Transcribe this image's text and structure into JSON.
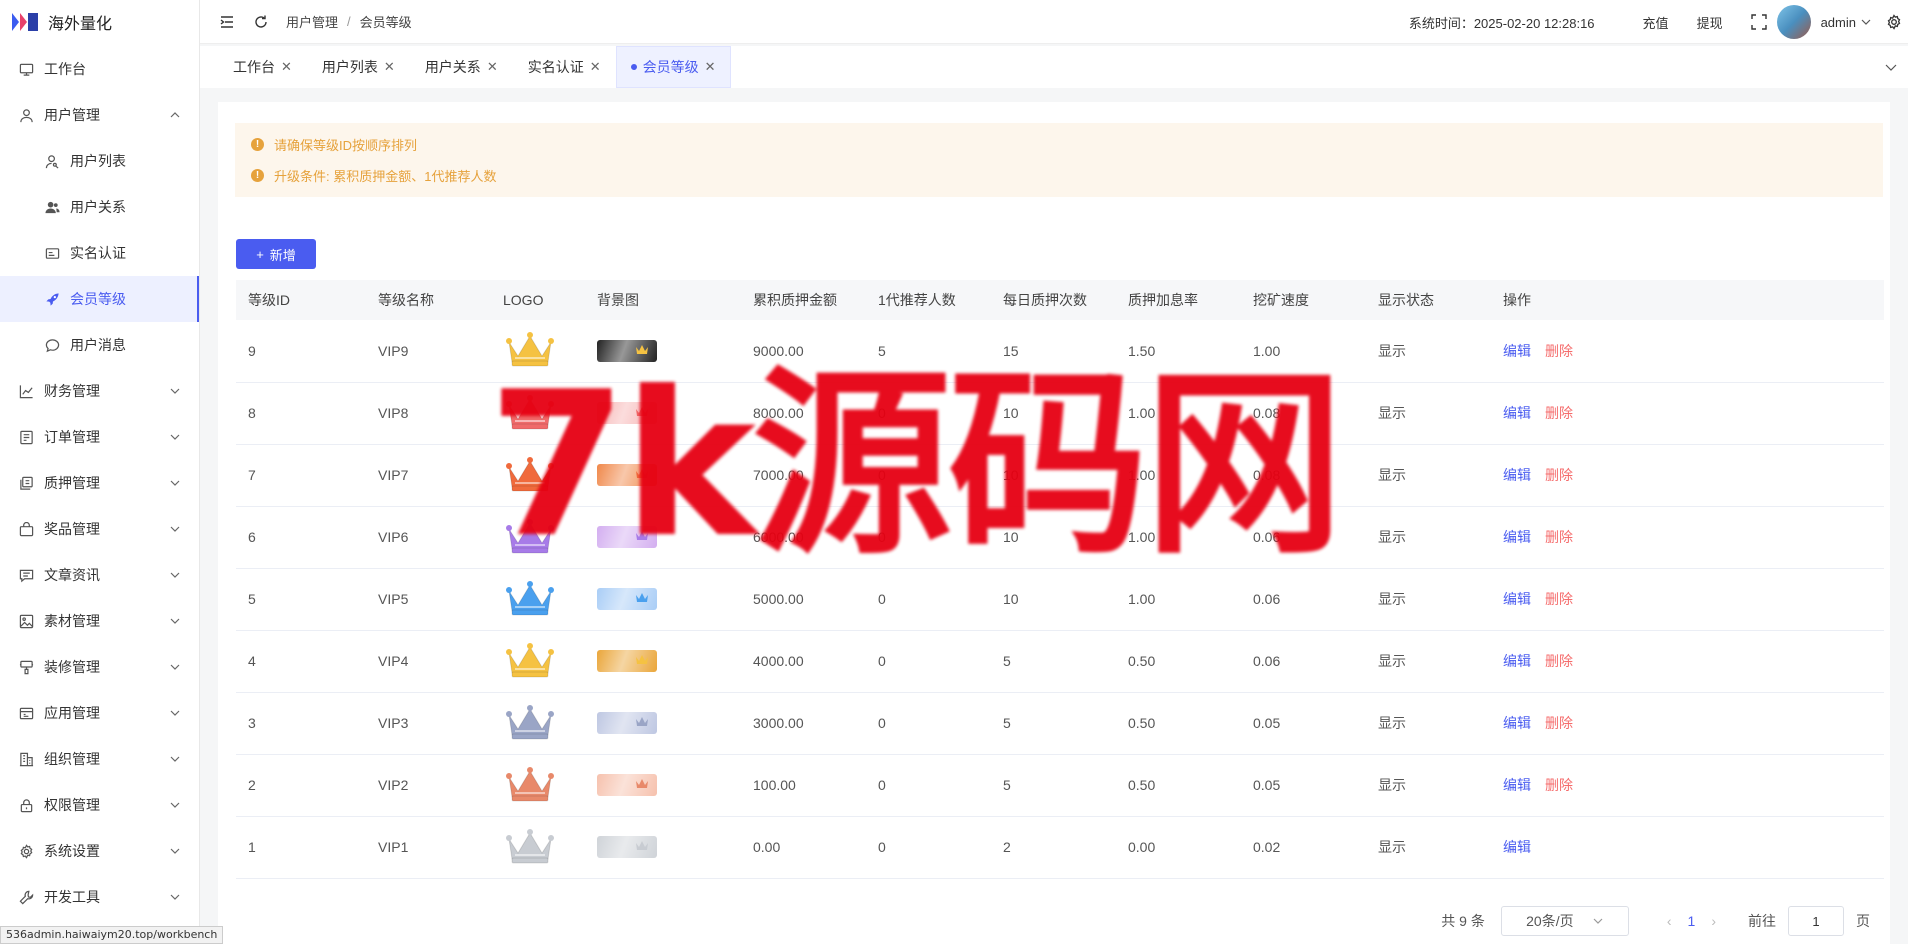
{
  "app": {
    "title": "海外量化"
  },
  "sidebar": {
    "items": [
      {
        "label": "工作台",
        "icon": "monitor-icon"
      },
      {
        "label": "用户管理",
        "icon": "user-icon",
        "expanded": true,
        "children": [
          {
            "label": "用户列表",
            "icon": "user-search-icon"
          },
          {
            "label": "用户关系",
            "icon": "users-icon"
          },
          {
            "label": "实名认证",
            "icon": "id-card-icon"
          },
          {
            "label": "会员等级",
            "icon": "rocket-icon",
            "active": true
          },
          {
            "label": "用户消息",
            "icon": "message-icon"
          }
        ]
      },
      {
        "label": "财务管理",
        "icon": "chart-icon"
      },
      {
        "label": "订单管理",
        "icon": "order-icon"
      },
      {
        "label": "质押管理",
        "icon": "stack-icon"
      },
      {
        "label": "奖品管理",
        "icon": "bag-icon"
      },
      {
        "label": "文章资讯",
        "icon": "article-icon"
      },
      {
        "label": "素材管理",
        "icon": "image-icon"
      },
      {
        "label": "装修管理",
        "icon": "brush-icon"
      },
      {
        "label": "应用管理",
        "icon": "app-icon"
      },
      {
        "label": "组织管理",
        "icon": "building-icon"
      },
      {
        "label": "权限管理",
        "icon": "lock-icon"
      },
      {
        "label": "系统设置",
        "icon": "gear-icon"
      },
      {
        "label": "开发工具",
        "icon": "tool-icon"
      }
    ]
  },
  "header": {
    "breadcrumb": [
      "用户管理",
      "会员等级"
    ],
    "sys_time": "系统时间：2025-02-20 12:28:16",
    "recharge": "充值",
    "withdraw": "提现",
    "user": "admin"
  },
  "tabs": [
    {
      "label": "工作台"
    },
    {
      "label": "用户列表"
    },
    {
      "label": "用户关系"
    },
    {
      "label": "实名认证"
    },
    {
      "label": "会员等级",
      "active": true
    }
  ],
  "alerts": [
    "请确保等级ID按顺序排列",
    "升级条件: 累积质押金额、1代推荐人数"
  ],
  "add_button": "新增",
  "table": {
    "columns": [
      "等级ID",
      "等级名称",
      "LOGO",
      "背景图",
      "累积质押金额",
      "1代推荐人数",
      "每日质押次数",
      "质押加息率",
      "挖矿速度",
      "显示状态",
      "操作"
    ],
    "edit_label": "编辑",
    "delete_label": "删除",
    "rows": [
      {
        "id": "9",
        "name": "VIP9",
        "amount": "9000.00",
        "refs": "5",
        "daily": "15",
        "rate": "1.50",
        "speed": "1.00",
        "status": "显示",
        "crown": "#f5c242",
        "bg": "#222222",
        "deletable": true
      },
      {
        "id": "8",
        "name": "VIP8",
        "amount": "8000.00",
        "refs": "0",
        "daily": "10",
        "rate": "1.00",
        "speed": "0.08",
        "status": "显示",
        "crown": "#f06a6a",
        "bg": "#f7b5b5",
        "deletable": true
      },
      {
        "id": "7",
        "name": "VIP7",
        "amount": "7000.00",
        "refs": "0",
        "daily": "10",
        "rate": "1.00",
        "speed": "0.08",
        "status": "显示",
        "crown": "#f06a3c",
        "bg": "#f0884a",
        "deletable": true
      },
      {
        "id": "6",
        "name": "VIP6",
        "amount": "6000.00",
        "refs": "0",
        "daily": "10",
        "rate": "1.00",
        "speed": "0.06",
        "status": "显示",
        "crown": "#a77be8",
        "bg": "#d3aef0",
        "deletable": true
      },
      {
        "id": "5",
        "name": "VIP5",
        "amount": "5000.00",
        "refs": "0",
        "daily": "10",
        "rate": "1.00",
        "speed": "0.06",
        "status": "显示",
        "crown": "#4aa0ee",
        "bg": "#a9cdf6",
        "deletable": true
      },
      {
        "id": "4",
        "name": "VIP4",
        "amount": "4000.00",
        "refs": "0",
        "daily": "5",
        "rate": "0.50",
        "speed": "0.06",
        "status": "显示",
        "crown": "#f5c242",
        "bg": "#eaa63a",
        "deletable": true
      },
      {
        "id": "3",
        "name": "VIP3",
        "amount": "3000.00",
        "refs": "0",
        "daily": "5",
        "rate": "0.50",
        "speed": "0.05",
        "status": "显示",
        "crown": "#9aa5c6",
        "bg": "#bec7e2",
        "deletable": true
      },
      {
        "id": "2",
        "name": "VIP2",
        "amount": "100.00",
        "refs": "0",
        "daily": "5",
        "rate": "0.50",
        "speed": "0.05",
        "status": "显示",
        "crown": "#e8896a",
        "bg": "#f6c1ad",
        "deletable": true
      },
      {
        "id": "1",
        "name": "VIP1",
        "amount": "0.00",
        "refs": "0",
        "daily": "2",
        "rate": "0.00",
        "speed": "0.02",
        "status": "显示",
        "crown": "#c8ccd2",
        "bg": "#cfd3d8",
        "deletable": false
      }
    ]
  },
  "pagination": {
    "total": "共 9 条",
    "page_size": "20条/页",
    "current": "1",
    "goto_label": "前往",
    "goto_value": "1",
    "page_suffix": "页"
  },
  "watermark": "7k源码网",
  "status_url": "536admin.haiwaiym20.top/workbench"
}
